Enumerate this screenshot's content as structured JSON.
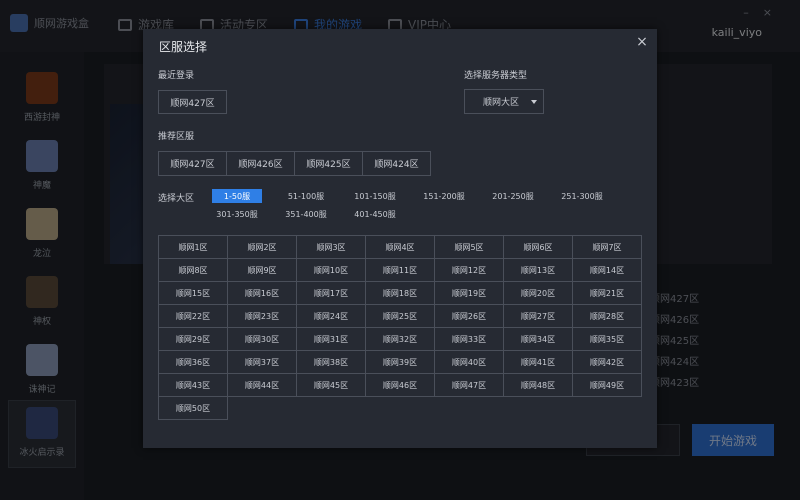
{
  "app": {
    "name": "顺网游戏盒",
    "user": "kaili_viyo",
    "nav": [
      "游戏库",
      "活动专区",
      "我的游戏",
      "VIP中心"
    ]
  },
  "sidebar": {
    "games": [
      {
        "name": "西游封神",
        "color": "#7a3a1a"
      },
      {
        "name": "神魔",
        "color": "#6a7fb0"
      },
      {
        "name": "龙泣",
        "color": "#b8a888"
      },
      {
        "name": "神权",
        "color": "#5a4a3a"
      },
      {
        "name": "诛神记",
        "color": "#8a9ab8"
      },
      {
        "name": "冰火启示录",
        "color": "#3a4a78"
      }
    ]
  },
  "background": {
    "server_list": [
      "顺网427区",
      "顺网426区",
      "顺网425区",
      "顺网424区",
      "顺网423区"
    ],
    "start_button": "开始游戏"
  },
  "modal": {
    "title": "区服选择",
    "close": "×",
    "recent_label": "最近登录",
    "recent_server": "顺网427区",
    "type_label": "选择服务器类型",
    "type_value": "顺网大区",
    "recommended_label": "推荐区服",
    "recommended": [
      "顺网427区",
      "顺网426区",
      "顺网425区",
      "顺网424区"
    ],
    "range_label": "选择大区",
    "ranges": [
      "1-50服",
      "51-100服",
      "101-150服",
      "151-200服",
      "201-250服",
      "251-300服",
      "301-350服",
      "351-400服",
      "401-450服"
    ],
    "active_range": "1-50服",
    "servers": [
      "顺网1区",
      "顺网2区",
      "顺网3区",
      "顺网4区",
      "顺网5区",
      "顺网6区",
      "顺网7区",
      "顺网8区",
      "顺网9区",
      "顺网10区",
      "顺网11区",
      "顺网12区",
      "顺网13区",
      "顺网14区",
      "顺网15区",
      "顺网16区",
      "顺网17区",
      "顺网18区",
      "顺网19区",
      "顺网20区",
      "顺网21区",
      "顺网22区",
      "顺网23区",
      "顺网24区",
      "顺网25区",
      "顺网26区",
      "顺网27区",
      "顺网28区",
      "顺网29区",
      "顺网30区",
      "顺网31区",
      "顺网32区",
      "顺网33区",
      "顺网34区",
      "顺网35区",
      "顺网36区",
      "顺网37区",
      "顺网38区",
      "顺网39区",
      "顺网40区",
      "顺网41区",
      "顺网42区",
      "顺网43区",
      "顺网44区",
      "顺网45区",
      "顺网46区",
      "顺网47区",
      "顺网48区",
      "顺网49区",
      "顺网50区"
    ]
  }
}
